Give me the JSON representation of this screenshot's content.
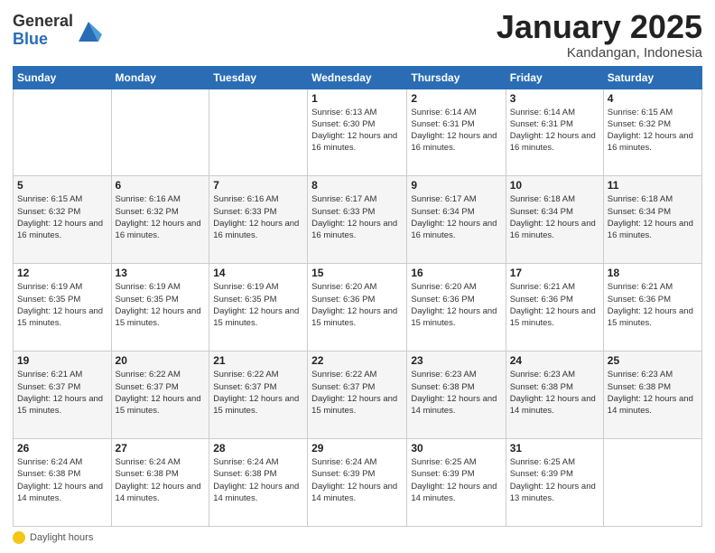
{
  "header": {
    "logo_general": "General",
    "logo_blue": "Blue",
    "title": "January 2025",
    "location": "Kandangan, Indonesia"
  },
  "columns": [
    "Sunday",
    "Monday",
    "Tuesday",
    "Wednesday",
    "Thursday",
    "Friday",
    "Saturday"
  ],
  "footer": {
    "label": "Daylight hours"
  },
  "weeks": [
    [
      {
        "day": "",
        "info": ""
      },
      {
        "day": "",
        "info": ""
      },
      {
        "day": "",
        "info": ""
      },
      {
        "day": "1",
        "info": "Sunrise: 6:13 AM\nSunset: 6:30 PM\nDaylight: 12 hours\nand 16 minutes."
      },
      {
        "day": "2",
        "info": "Sunrise: 6:14 AM\nSunset: 6:31 PM\nDaylight: 12 hours\nand 16 minutes."
      },
      {
        "day": "3",
        "info": "Sunrise: 6:14 AM\nSunset: 6:31 PM\nDaylight: 12 hours\nand 16 minutes."
      },
      {
        "day": "4",
        "info": "Sunrise: 6:15 AM\nSunset: 6:32 PM\nDaylight: 12 hours\nand 16 minutes."
      }
    ],
    [
      {
        "day": "5",
        "info": "Sunrise: 6:15 AM\nSunset: 6:32 PM\nDaylight: 12 hours\nand 16 minutes."
      },
      {
        "day": "6",
        "info": "Sunrise: 6:16 AM\nSunset: 6:32 PM\nDaylight: 12 hours\nand 16 minutes."
      },
      {
        "day": "7",
        "info": "Sunrise: 6:16 AM\nSunset: 6:33 PM\nDaylight: 12 hours\nand 16 minutes."
      },
      {
        "day": "8",
        "info": "Sunrise: 6:17 AM\nSunset: 6:33 PM\nDaylight: 12 hours\nand 16 minutes."
      },
      {
        "day": "9",
        "info": "Sunrise: 6:17 AM\nSunset: 6:34 PM\nDaylight: 12 hours\nand 16 minutes."
      },
      {
        "day": "10",
        "info": "Sunrise: 6:18 AM\nSunset: 6:34 PM\nDaylight: 12 hours\nand 16 minutes."
      },
      {
        "day": "11",
        "info": "Sunrise: 6:18 AM\nSunset: 6:34 PM\nDaylight: 12 hours\nand 16 minutes."
      }
    ],
    [
      {
        "day": "12",
        "info": "Sunrise: 6:19 AM\nSunset: 6:35 PM\nDaylight: 12 hours\nand 15 minutes."
      },
      {
        "day": "13",
        "info": "Sunrise: 6:19 AM\nSunset: 6:35 PM\nDaylight: 12 hours\nand 15 minutes."
      },
      {
        "day": "14",
        "info": "Sunrise: 6:19 AM\nSunset: 6:35 PM\nDaylight: 12 hours\nand 15 minutes."
      },
      {
        "day": "15",
        "info": "Sunrise: 6:20 AM\nSunset: 6:36 PM\nDaylight: 12 hours\nand 15 minutes."
      },
      {
        "day": "16",
        "info": "Sunrise: 6:20 AM\nSunset: 6:36 PM\nDaylight: 12 hours\nand 15 minutes."
      },
      {
        "day": "17",
        "info": "Sunrise: 6:21 AM\nSunset: 6:36 PM\nDaylight: 12 hours\nand 15 minutes."
      },
      {
        "day": "18",
        "info": "Sunrise: 6:21 AM\nSunset: 6:36 PM\nDaylight: 12 hours\nand 15 minutes."
      }
    ],
    [
      {
        "day": "19",
        "info": "Sunrise: 6:21 AM\nSunset: 6:37 PM\nDaylight: 12 hours\nand 15 minutes."
      },
      {
        "day": "20",
        "info": "Sunrise: 6:22 AM\nSunset: 6:37 PM\nDaylight: 12 hours\nand 15 minutes."
      },
      {
        "day": "21",
        "info": "Sunrise: 6:22 AM\nSunset: 6:37 PM\nDaylight: 12 hours\nand 15 minutes."
      },
      {
        "day": "22",
        "info": "Sunrise: 6:22 AM\nSunset: 6:37 PM\nDaylight: 12 hours\nand 15 minutes."
      },
      {
        "day": "23",
        "info": "Sunrise: 6:23 AM\nSunset: 6:38 PM\nDaylight: 12 hours\nand 14 minutes."
      },
      {
        "day": "24",
        "info": "Sunrise: 6:23 AM\nSunset: 6:38 PM\nDaylight: 12 hours\nand 14 minutes."
      },
      {
        "day": "25",
        "info": "Sunrise: 6:23 AM\nSunset: 6:38 PM\nDaylight: 12 hours\nand 14 minutes."
      }
    ],
    [
      {
        "day": "26",
        "info": "Sunrise: 6:24 AM\nSunset: 6:38 PM\nDaylight: 12 hours\nand 14 minutes."
      },
      {
        "day": "27",
        "info": "Sunrise: 6:24 AM\nSunset: 6:38 PM\nDaylight: 12 hours\nand 14 minutes."
      },
      {
        "day": "28",
        "info": "Sunrise: 6:24 AM\nSunset: 6:38 PM\nDaylight: 12 hours\nand 14 minutes."
      },
      {
        "day": "29",
        "info": "Sunrise: 6:24 AM\nSunset: 6:39 PM\nDaylight: 12 hours\nand 14 minutes."
      },
      {
        "day": "30",
        "info": "Sunrise: 6:25 AM\nSunset: 6:39 PM\nDaylight: 12 hours\nand 14 minutes."
      },
      {
        "day": "31",
        "info": "Sunrise: 6:25 AM\nSunset: 6:39 PM\nDaylight: 12 hours\nand 13 minutes."
      },
      {
        "day": "",
        "info": ""
      }
    ]
  ]
}
